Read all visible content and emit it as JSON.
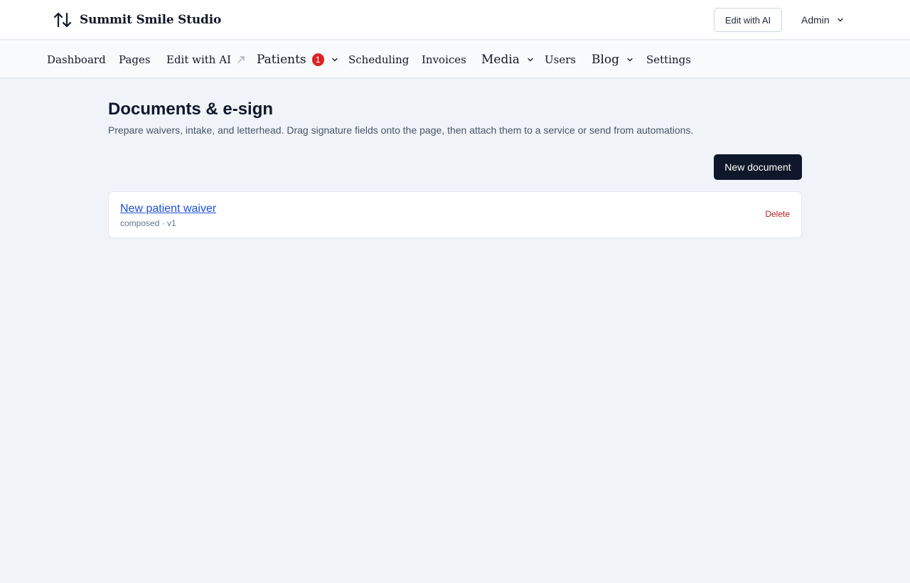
{
  "header": {
    "brand_name": "Summit Smile Studio",
    "brand_icon": "arrows-up-down-icon",
    "edit_ai_label": "Edit with AI",
    "user_label": "Admin"
  },
  "nav": {
    "items": [
      {
        "label": "Dashboard"
      },
      {
        "label": "Pages"
      },
      {
        "label": "Edit with AI",
        "icon": "external-arrow-icon"
      },
      {
        "label": "Patients",
        "badge": "1",
        "dropdown": true
      },
      {
        "label": "Scheduling"
      },
      {
        "label": "Invoices"
      },
      {
        "label": "Media",
        "dropdown": true
      },
      {
        "label": "Users"
      },
      {
        "label": "Blog",
        "dropdown": true
      },
      {
        "label": "Settings"
      }
    ]
  },
  "main": {
    "title": "Documents & e-sign",
    "description": "Prepare waivers, intake, and letterhead. Drag signature fields onto the page, then attach them to a service or send from automations.",
    "new_document_label": "New document",
    "documents": [
      {
        "title": "New patient waiver",
        "meta": "composed · v1",
        "delete_label": "Delete"
      }
    ]
  },
  "colors": {
    "page_bg": "#f0f4f9",
    "primary_button": "#0f172a",
    "link": "#1d4ed8",
    "danger": "#b91c1c",
    "badge": "#dc2626"
  }
}
